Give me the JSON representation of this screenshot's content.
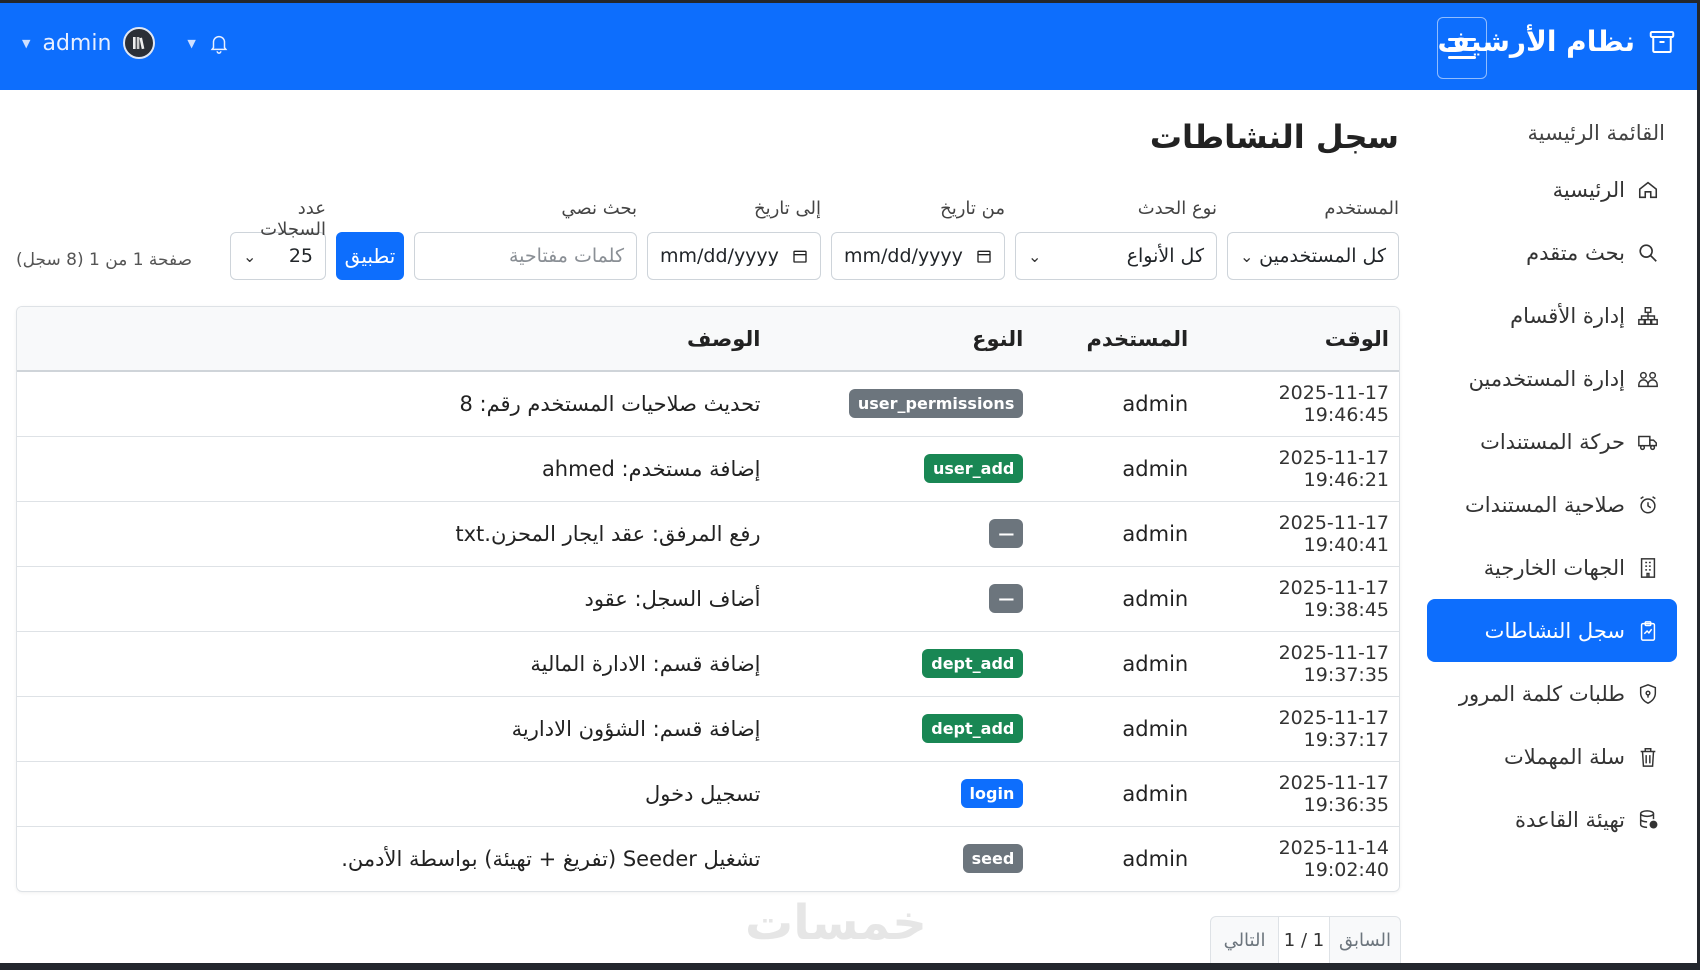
{
  "app": {
    "title": "نظام الأرشيف",
    "user": "admin"
  },
  "sidebar": {
    "heading": "القائمة الرئيسية",
    "items": [
      {
        "label": "الرئيسية",
        "icon": "home-icon"
      },
      {
        "label": "بحث متقدم",
        "icon": "search-icon"
      },
      {
        "label": "إدارة الأقسام",
        "icon": "sitemap-icon"
      },
      {
        "label": "إدارة المستخدمين",
        "icon": "users-icon"
      },
      {
        "label": "حركة المستندات",
        "icon": "truck-icon"
      },
      {
        "label": "صلاحية المستندات",
        "icon": "alarm-icon"
      },
      {
        "label": "الجهات الخارجية",
        "icon": "building-icon"
      },
      {
        "label": "سجل النشاطات",
        "icon": "clipboard-icon",
        "active": true
      },
      {
        "label": "طلبات كلمة المرور",
        "icon": "shield-icon"
      },
      {
        "label": "سلة المهملات",
        "icon": "trash-icon"
      },
      {
        "label": "تهيئة القاعدة",
        "icon": "database-icon"
      }
    ]
  },
  "page": {
    "title": "سجل النشاطات"
  },
  "filters": {
    "user_label": "المستخدم",
    "user_value": "كل المستخدمين",
    "type_label": "نوع الحدث",
    "type_value": "كل الأنواع",
    "from_label": "من تاريخ",
    "from_value": "mm/dd/yyyy",
    "to_label": "إلى تاريخ",
    "to_value": "mm/dd/yyyy",
    "search_label": "بحث نصي",
    "search_placeholder": "كلمات مفتاحية",
    "count_label": "عدد السجلات",
    "count_value": "25",
    "apply": "تطبيق",
    "page_info": "صفحة 1 من 1 (8 سجل)"
  },
  "table": {
    "headers": {
      "time": "الوقت",
      "user": "المستخدم",
      "type": "النوع",
      "desc": "الوصف"
    },
    "rows": [
      {
        "time": "2025-11-17 19:46:45",
        "user": "admin",
        "type": "user_permissions",
        "desc": "تحديث صلاحيات المستخدم رقم: 8"
      },
      {
        "time": "2025-11-17 19:46:21",
        "user": "admin",
        "type": "user_add",
        "desc": "إضافة مستخدم: ahmed"
      },
      {
        "time": "2025-11-17 19:40:41",
        "user": "admin",
        "type": "—",
        "desc": "رفع المرفق: عقد ايجار المحزن.txt"
      },
      {
        "time": "2025-11-17 19:38:45",
        "user": "admin",
        "type": "—",
        "desc": "أضاف السجل: عقود"
      },
      {
        "time": "2025-11-17 19:37:35",
        "user": "admin",
        "type": "dept_add",
        "desc": "إضافة قسم: الادارة المالية"
      },
      {
        "time": "2025-11-17 19:37:17",
        "user": "admin",
        "type": "dept_add",
        "desc": "إضافة قسم: الشؤون الادارية"
      },
      {
        "time": "2025-11-17 19:36:35",
        "user": "admin",
        "type": "login",
        "desc": "تسجيل دخول"
      },
      {
        "time": "2025-11-14 19:02:40",
        "user": "admin",
        "type": "seed",
        "desc": "تشغيل Seeder (تفريغ + تهيئة) بواسطة الأدمن."
      }
    ]
  },
  "badge_colors": {
    "user_permissions": "#6c757d",
    "user_add": "#198754",
    "—": "#6c757d",
    "dept_add": "#198754",
    "login": "#0d6efd",
    "seed": "#6c757d"
  },
  "pagination": {
    "prev": "السابق",
    "current": "1 / 1",
    "next": "التالي"
  },
  "watermark": "خمسات"
}
